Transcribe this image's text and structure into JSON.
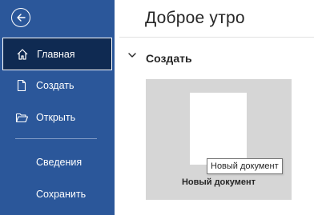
{
  "sidebar": {
    "back_icon": "arrow-left-circle-icon",
    "items": [
      {
        "label": "Главная",
        "icon": "home-icon",
        "active": true
      },
      {
        "label": "Создать",
        "icon": "new-document-icon"
      },
      {
        "label": "Открыть",
        "icon": "folder-open-icon"
      },
      {
        "label": "Сведения"
      },
      {
        "label": "Сохранить"
      }
    ],
    "colors": {
      "background": "#2b579a",
      "active": "#0f2a52"
    }
  },
  "main": {
    "greeting": "Доброе утро",
    "section": {
      "title": "Создать",
      "toggle_icon": "chevron-down-icon",
      "expanded": true
    },
    "templates": [
      {
        "label": "Новый документ",
        "tooltip": "Новый документ"
      }
    ]
  }
}
